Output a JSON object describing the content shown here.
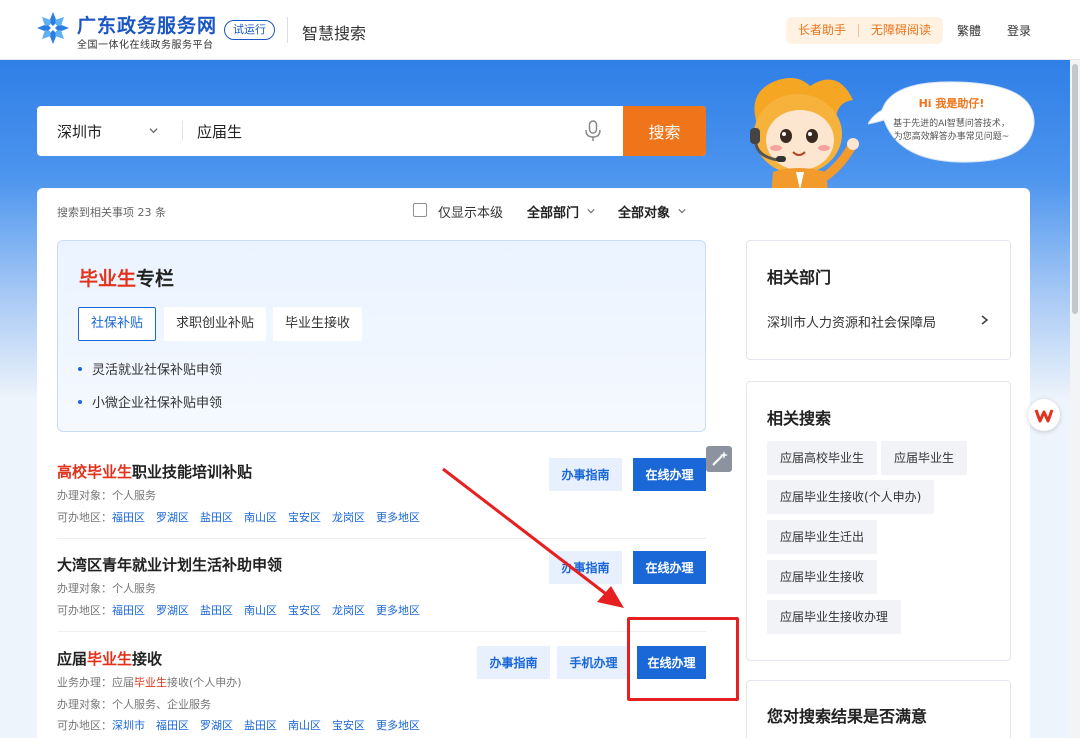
{
  "header": {
    "site_name": "广东政务服务网",
    "site_sub": "全国一体化在线政务服务平台",
    "beta": "试运行",
    "title": "智慧搜索",
    "elder_mode": "长者助手",
    "accessible": "无障碍阅读",
    "traditional": "繁體",
    "login": "登录"
  },
  "search": {
    "city": "深圳市",
    "query": "应届生",
    "button": "搜索"
  },
  "assistant": {
    "greeting": "Hi 我是助仔!",
    "line1": "基于先进的AI智慧问答技术，",
    "line2": "为您高效解答办事常见问题~"
  },
  "toolbar": {
    "result_count": "搜索到相关事项 23 条",
    "only_local": "仅显示本级",
    "all_depts": "全部部门",
    "all_targets": "全部对象"
  },
  "graduate": {
    "title_hl": "毕业生",
    "title_rest": "专栏",
    "tabs": [
      "社保补贴",
      "求职创业补贴",
      "毕业生接收"
    ],
    "items": [
      "灵活就业社保补贴申领",
      "小微企业社保补贴申领"
    ]
  },
  "results": [
    {
      "title_parts": [
        "高校",
        "毕业生",
        "职业技能培训补贴"
      ],
      "target": "办理对象：个人服务",
      "areas_label": "可办地区：",
      "areas": [
        "福田区",
        "罗湖区",
        "盐田区",
        "南山区",
        "宝安区",
        "龙岗区",
        "更多地区"
      ],
      "guide": "办事指南",
      "online": "在线办理"
    },
    {
      "title": "大湾区青年就业计划生活补助申领",
      "target": "办理对象：个人服务",
      "areas_label": "可办地区：",
      "areas": [
        "福田区",
        "罗湖区",
        "盐田区",
        "南山区",
        "宝安区",
        "龙岗区",
        "更多地区"
      ],
      "guide": "办事指南",
      "online": "在线办理"
    },
    {
      "title_parts": [
        "应届",
        "毕业生",
        "接收"
      ],
      "business_parts": [
        "业务办理：应届",
        "毕业生",
        "接收(个人申办)"
      ],
      "target": "办理对象：个人服务、企业服务",
      "areas_label": "可办地区：",
      "areas": [
        "深圳市",
        "福田区",
        "罗湖区",
        "盐田区",
        "南山区",
        "宝安区",
        "更多地区"
      ],
      "guide": "办事指南",
      "mobile": "手机办理",
      "online": "在线办理"
    }
  ],
  "sidebar": {
    "dept_title": "相关部门",
    "dept_name": "深圳市人力资源和社会保障局",
    "related_title": "相关搜索",
    "related": [
      "应届高校毕业生",
      "应届毕业生",
      "应届毕业生接收(个人申办)",
      "应届毕业生迁出",
      "应届毕业生接收",
      "应届毕业生接收办理"
    ],
    "feedback_title": "您对搜索结果是否满意"
  },
  "colors": {
    "brand": "#1a56c4",
    "primary": "#1a67d8",
    "orange": "#f0741a",
    "highlight": "#e3311c",
    "annotation": "#e62020"
  }
}
